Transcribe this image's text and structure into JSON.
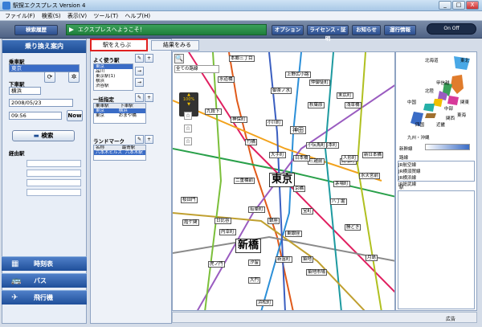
{
  "window": {
    "title": "駅探エクスプレス Version 4",
    "min": "_",
    "max": "□",
    "close": "X"
  },
  "menu": [
    "ファイル(F)",
    "検索(S)",
    "表示(V)",
    "ツール(T)",
    "ヘルプ(H)"
  ],
  "toolbar": {
    "history": "検索履歴",
    "welcome": "エクスプレスへようこそ！",
    "options": "オプション",
    "license": "ライセンス・証明",
    "notice": "お知らせ",
    "operation": "運行情報",
    "switch": "On  Off"
  },
  "sidebar": {
    "header": "乗り換え案内",
    "board_label": "乗車駅",
    "board_value": "東京",
    "alight_label": "下車駅",
    "alight_value": "横浜",
    "date": "2008/05/23",
    "time": "09:56",
    "now_btn": "Now",
    "search_btn": "検索",
    "via_label": "経由駅",
    "nav": [
      {
        "label": "時刻表",
        "icon": "▦"
      },
      {
        "label": "バス",
        "icon": "🚌"
      },
      {
        "label": "飛行機",
        "icon": "✈"
      }
    ]
  },
  "tabs": {
    "select": "駅をえらぶ",
    "result": "結果をみる"
  },
  "mid": {
    "frequent_label": "よく使う駅",
    "frequent": [
      "東京",
      "品川",
      "東京駅(1)",
      "横浜",
      "渋谷駅"
    ],
    "onebus_label": "一括指定",
    "onebus_head": [
      "乗車駅",
      "下車駅"
    ],
    "onebus_rows": [
      [
        "東京",
        "横浜"
      ],
      [
        "東京",
        "おまや橋"
      ]
    ],
    "landmark_label": "ランドマーク",
    "landmark_head": [
      "名称",
      "最寄駅"
    ],
    "landmark_rows": [
      [
        "六本木ヒルズ",
        "六本木駅"
      ]
    ]
  },
  "map": {
    "route_select": "全ての路線",
    "zoom": "100%",
    "stations_big": [
      "東京",
      "新橋"
    ],
    "stations_mid": [
      "神田"
    ],
    "stations": [
      "本郷三丁目",
      "水道橋",
      "御茶ノ水",
      "秋葉原",
      "浅草橋",
      "九段下",
      "神保町",
      "小川町",
      "大手町",
      "三越前",
      "馬喰町",
      "人形町",
      "水天宮前",
      "茅場町",
      "二重橋前",
      "八丁堀",
      "有楽町",
      "日比谷",
      "霞ケ関",
      "銀座",
      "東銀座",
      "内幸町",
      "汐留",
      "大門",
      "浜松町",
      "月島",
      "新富町",
      "築地",
      "築地市場",
      "上野広小路",
      "仲御徒町",
      "末広町",
      "岩本町",
      "小伝馬町",
      "日本橋",
      "京橋",
      "宝町",
      "勝どき",
      "桜田門",
      "竹橋",
      "虎ノ門",
      "新日本橋"
    ]
  },
  "right": {
    "regions": [
      "北海道",
      "東北",
      "甲信越",
      "北陸",
      "関東",
      "中部",
      "近畿",
      "中国",
      "四国",
      "東海",
      "関西",
      "九州・沖縄"
    ],
    "shinkansen": "新幹線",
    "lines_label": "路線",
    "lines": [
      "JR航空線",
      "JR横須賀線",
      "JR横浜線",
      "JR総武線"
    ],
    "station_label": "駅"
  },
  "status": "広告",
  "colors": {
    "accent": "#2c4f8e",
    "welcome": "#1f7f3b",
    "tab_outline": "#e02020"
  }
}
